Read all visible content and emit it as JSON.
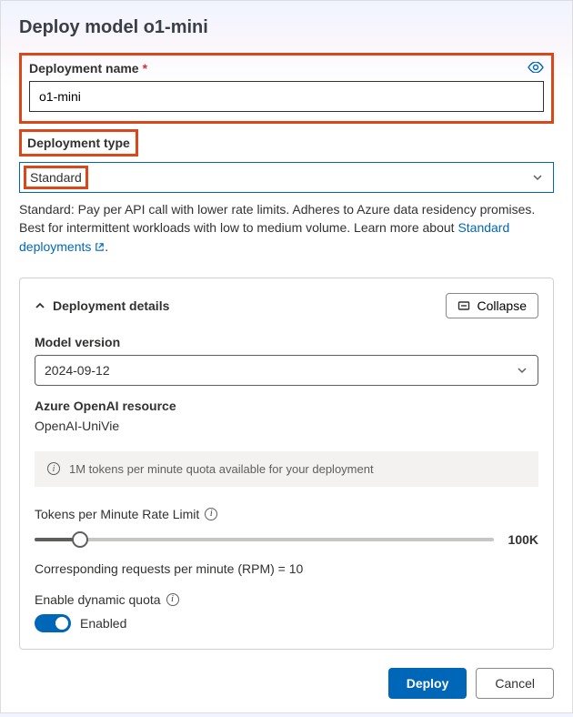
{
  "dialog": {
    "title": "Deploy model o1-mini"
  },
  "deployment_name": {
    "label": "Deployment name",
    "required_marker": "*",
    "value": "o1-mini"
  },
  "deployment_type": {
    "label": "Deployment type",
    "selected": "Standard",
    "description_prefix": "Standard: Pay per API call with lower rate limits. Adheres to Azure data residency promises. Best for intermittent workloads with low to medium volume. Learn more about ",
    "link_text": "Standard deployments",
    "description_suffix": "."
  },
  "details": {
    "title": "Deployment details",
    "collapse_label": "Collapse",
    "model_version_label": "Model version",
    "model_version_value": "2024-09-12",
    "resource_label": "Azure OpenAI resource",
    "resource_value": "OpenAI-UniVie",
    "quota_banner": "1M tokens per minute quota available for your deployment",
    "rate_limit_label": "Tokens per Minute Rate Limit",
    "rate_limit_value": "100K",
    "rate_limit_percent": 10,
    "rpm_text": "Corresponding requests per minute (RPM) = 10",
    "dynamic_quota_label": "Enable dynamic quota",
    "dynamic_quota_state": "Enabled"
  },
  "footer": {
    "deploy": "Deploy",
    "cancel": "Cancel"
  }
}
